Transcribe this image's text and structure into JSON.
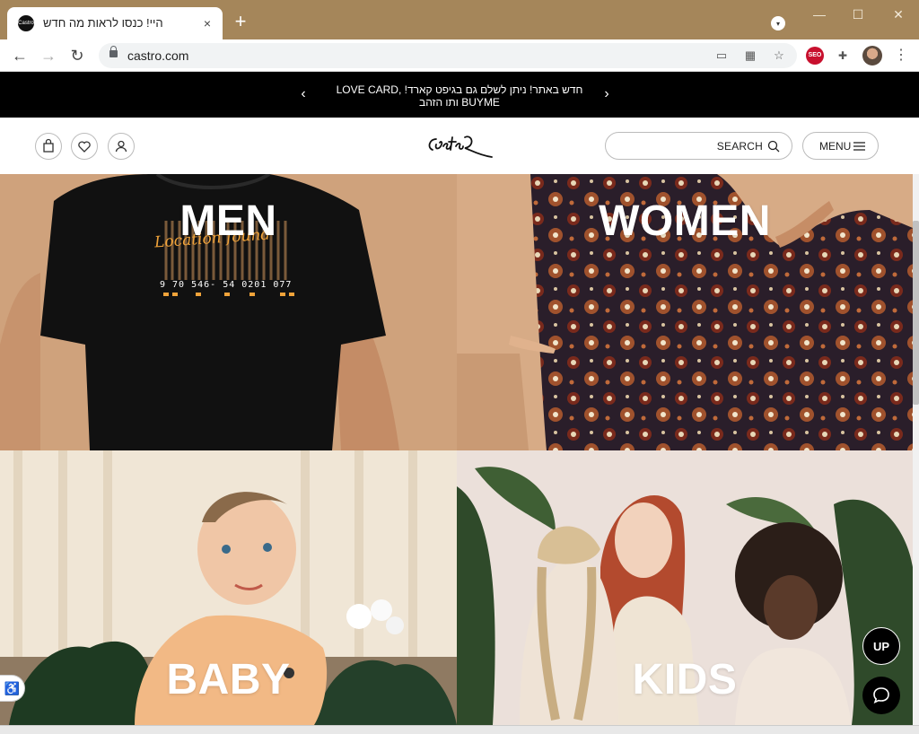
{
  "browser": {
    "tab_title": "היי! כנסו לראות מה חדש",
    "tab_favicon_text": "Castro",
    "url": "castro.com",
    "ext_seo": "SEO",
    "new_tab": "+",
    "close": "×",
    "minimize": "—",
    "maximize": "☐",
    "window_close": "✕"
  },
  "promo": {
    "text": "חדש באתר! ניתן לשלם גם בגיפט קארד! LOVE CARD, BUYME ותו הזהב",
    "prev": "‹",
    "next": "›"
  },
  "header": {
    "search_label": "SEARCH",
    "menu_label": "MENU",
    "logo_alt": "Castro"
  },
  "tiles": {
    "men": "MEN",
    "women": "WOMEN",
    "baby": "BABY",
    "kids": "KIDS"
  },
  "men_shirt": {
    "script_text": "Location found",
    "barcode_number": "9 70 546- 54 0201 077"
  },
  "floating": {
    "up_label": "UP",
    "a11y_icon": "♿"
  },
  "colors": {
    "titlebar": "#a5865a",
    "promo_bg": "#000000",
    "tile_label": "#ffffff"
  }
}
